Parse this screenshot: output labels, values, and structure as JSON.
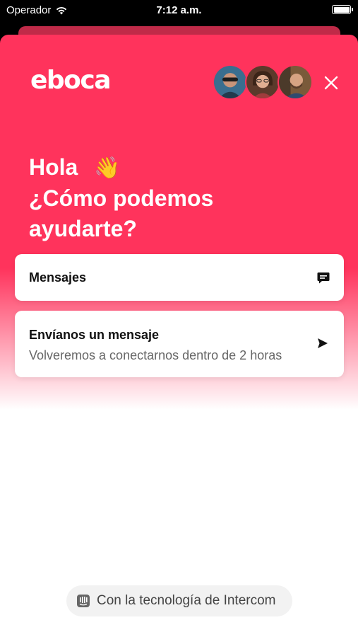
{
  "status_bar": {
    "carrier": "Operador",
    "time": "7:12 a.m."
  },
  "header": {
    "logo_text": "eboca",
    "avatars": [
      "avatar-1",
      "avatar-2",
      "avatar-3"
    ]
  },
  "greeting": {
    "line1": "Hola",
    "wave_emoji": "👋",
    "line2": "¿Cómo podemos",
    "line3": "ayudarte?"
  },
  "cards": {
    "messages": {
      "title": "Mensajes",
      "icon": "message-icon"
    },
    "send_message": {
      "title": "Envíanos un mensaje",
      "subtitle": "Volveremos a conectarnos dentro de 2 horas",
      "icon": "send-icon"
    }
  },
  "footer": {
    "powered_by": "Con la tecnología de Intercom",
    "icon": "intercom-icon"
  },
  "colors": {
    "brand": "#ff335c",
    "back_sheet": "#c02a48",
    "card_bg": "#ffffff",
    "text_dark": "#111111",
    "text_muted": "#666666"
  }
}
